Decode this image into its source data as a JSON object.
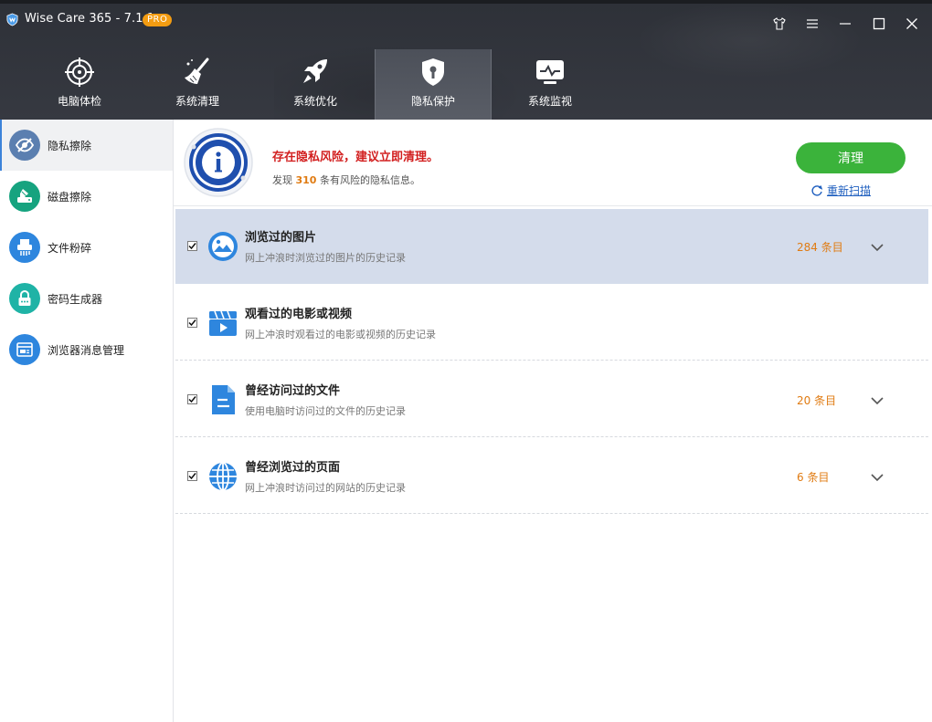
{
  "window": {
    "title": "Wise Care 365 - 7.1.1",
    "badge": "PRO"
  },
  "top_tabs": [
    {
      "label": "电脑体检",
      "icon": "crosshair-icon",
      "active": false
    },
    {
      "label": "系统清理",
      "icon": "broom-icon",
      "active": false
    },
    {
      "label": "系统优化",
      "icon": "rocket-icon",
      "active": false
    },
    {
      "label": "隐私保护",
      "icon": "shield-keyhole-icon",
      "active": true
    },
    {
      "label": "系统监视",
      "icon": "monitor-icon",
      "active": false
    }
  ],
  "sidebar": {
    "items": [
      {
        "label": "隐私擦除",
        "icon": "eye-slash-icon",
        "active": true,
        "color": "#5b7fb0"
      },
      {
        "label": "磁盘擦除",
        "icon": "disk-eraser-icon",
        "active": false,
        "color": "#16a37f"
      },
      {
        "label": "文件粉碎",
        "icon": "shredder-icon",
        "active": false,
        "color": "#2e86de"
      },
      {
        "label": "密码生成器",
        "icon": "lock-icon",
        "active": false,
        "color": "#1fb3a6"
      },
      {
        "label": "浏览器消息管理",
        "icon": "browser-notification-icon",
        "active": false,
        "color": "#2e86de"
      }
    ]
  },
  "alert": {
    "title": "存在隐私风险，建议立即清理。",
    "desc_prefix": "发现 ",
    "count": "310",
    "desc_suffix": " 条有风险的隐私信息。",
    "clean_button": "清理",
    "rescan": "重新扫描"
  },
  "items": [
    {
      "title": "浏览过的图片",
      "desc": "网上冲浪时浏览过的图片的历史记录",
      "count": "284 条目",
      "checked": true,
      "selected": true,
      "icon": "image-icon",
      "has_expand": true
    },
    {
      "title": "观看过的电影或视频",
      "desc": "网上冲浪时观看过的电影或视频的历史记录",
      "count": "",
      "checked": true,
      "selected": false,
      "icon": "video-icon",
      "has_expand": false
    },
    {
      "title": "曾经访问过的文件",
      "desc": "使用电脑时访问过的文件的历史记录",
      "count": "20 条目",
      "checked": true,
      "selected": false,
      "icon": "document-icon",
      "has_expand": true
    },
    {
      "title": "曾经浏览过的页面",
      "desc": "网上冲浪时访问过的网站的历史记录",
      "count": "6 条目",
      "checked": true,
      "selected": false,
      "icon": "globe-icon",
      "has_expand": true
    }
  ],
  "colors": {
    "accent": "#3c83d9",
    "clean_button": "#3bb33b",
    "warning": "#d21f1f",
    "count": "#e07b12",
    "selected_row": "#d4dceb"
  }
}
